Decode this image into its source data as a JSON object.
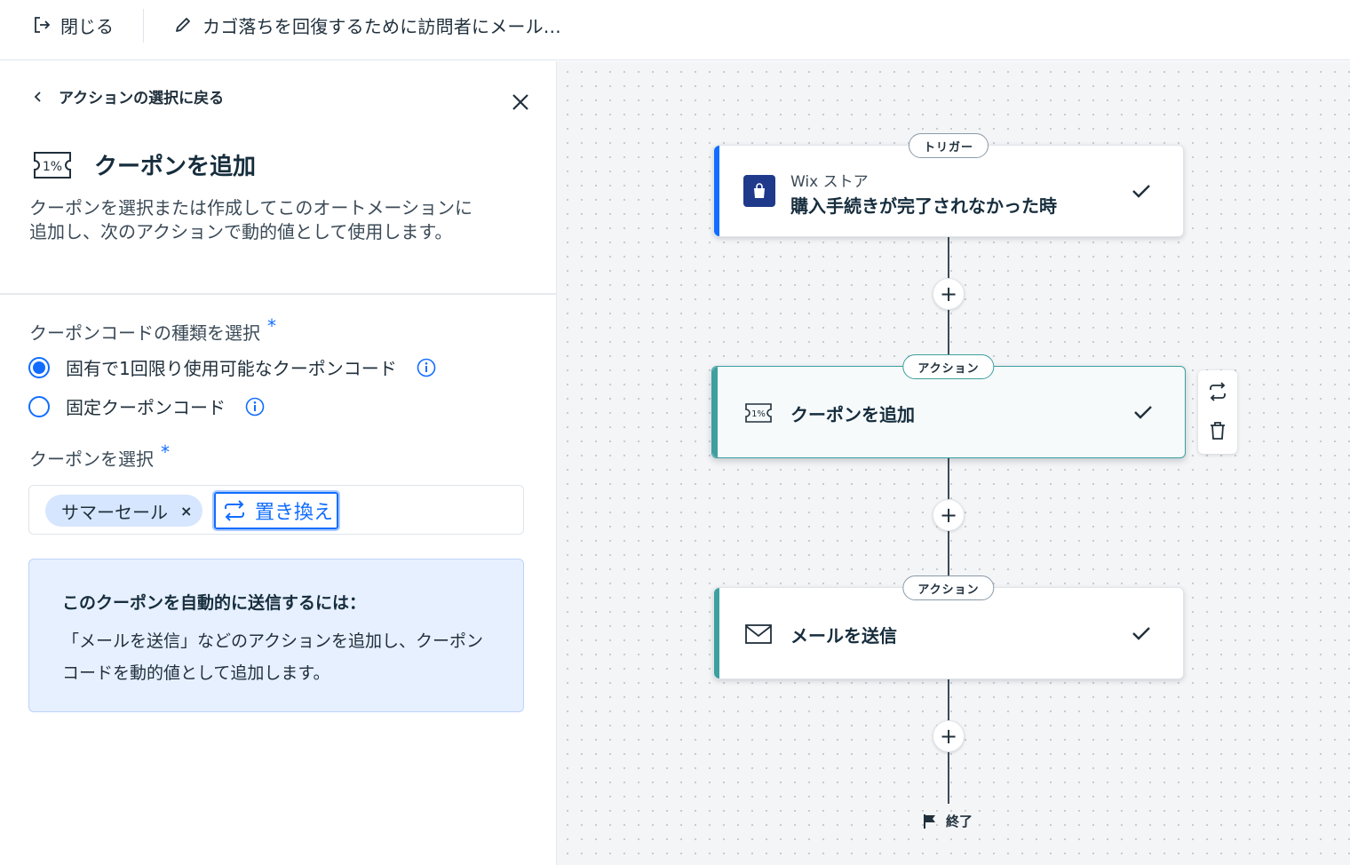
{
  "topbar": {
    "close_label": "閉じる",
    "automation_title": "カゴ落ちを回復するために訪問者にメール…"
  },
  "panel": {
    "back_label": "アクションの選択に戻る",
    "title": "クーポンを追加",
    "description": "クーポンを選択または作成してこのオートメーションに追加し、次のアクションで動的値として使用します。",
    "coupon_type_label": "クーポンコードの種類を選択",
    "required_mark": "*",
    "radio_options": [
      {
        "label": "固有で1回限り使用可能なクーポンコード",
        "checked": true
      },
      {
        "label": "固定クーポンコード",
        "checked": false
      }
    ],
    "select_coupon_label": "クーポンを選択",
    "selected_coupon": "サマーセール",
    "chip_remove": "×",
    "replace_label": "置き換え",
    "info_box": {
      "title": "このクーポンを自動的に送信するには：",
      "text": "「メールを送信」などのアクションを追加し、クーポンコードを動的値として追加します。"
    }
  },
  "canvas": {
    "trigger": {
      "pill": "トリガー",
      "app_name": "Wix ストア",
      "title": "購入手続きが完了されなかった時"
    },
    "action1": {
      "pill": "アクション",
      "title": "クーポンを追加"
    },
    "action2": {
      "pill": "アクション",
      "title": "メールを送信"
    },
    "plus": "+",
    "end_label": "終了"
  },
  "colors": {
    "accent_blue": "#116dff",
    "trigger_accent": "#116dff",
    "action_accent": "#3d9f9f",
    "info_bg": "#e7f0ff",
    "chip_bg": "#d6e6fe"
  }
}
